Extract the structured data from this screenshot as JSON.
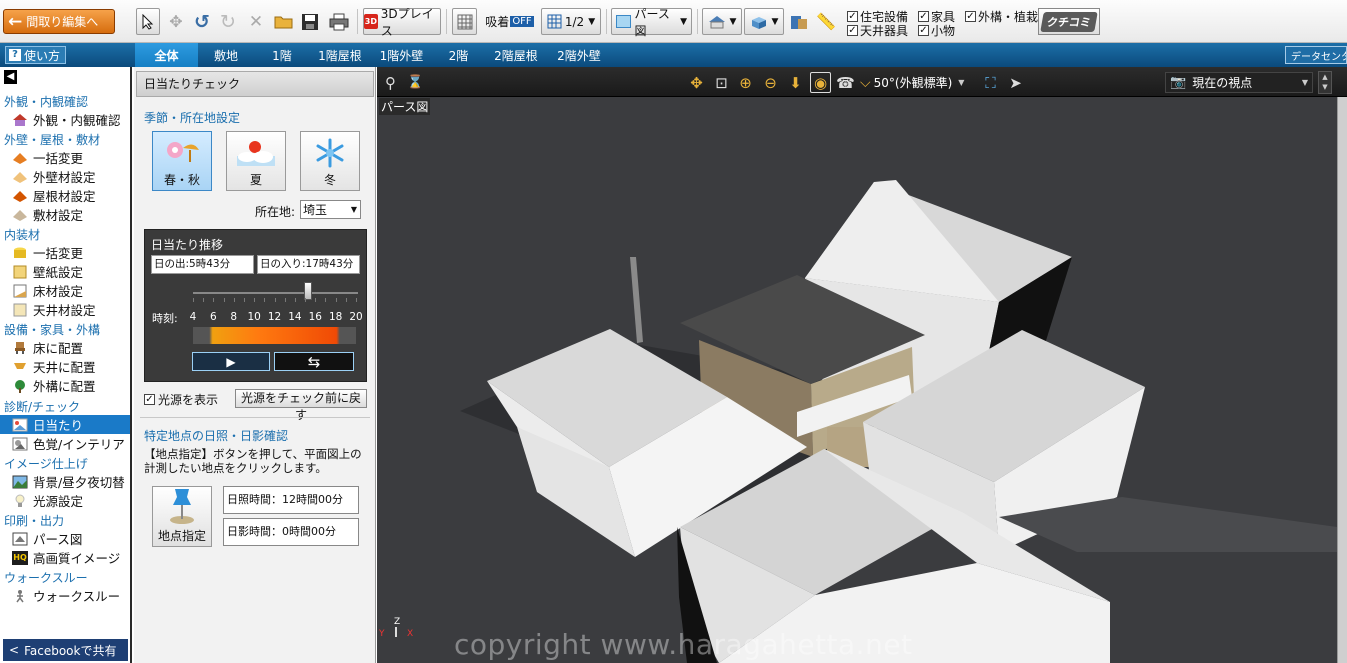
{
  "toolbar": {
    "madori_label": "間取り編集へ",
    "place3d_label": "3Dプレイス",
    "snap_label": "吸着",
    "snap_state": "OFF",
    "grid_label": "1/2",
    "view_label": "パース図",
    "checks": [
      {
        "label": "住宅設備",
        "checked": true
      },
      {
        "label": "家具",
        "checked": true
      },
      {
        "label": "外構・植栽",
        "checked": true
      },
      {
        "label": "天井器具",
        "checked": true
      },
      {
        "label": "小物",
        "checked": true
      }
    ],
    "kuchikomi_label": "クチコミ"
  },
  "tabbar": {
    "help_label": "使い方",
    "tabs": [
      "全体",
      "敷地",
      "1階",
      "1階屋根",
      "1階外壁",
      "2階",
      "2階屋根",
      "2階外壁"
    ],
    "selected_tab": "全体",
    "dataset_label": "データセンター"
  },
  "sidebar": {
    "sections": [
      {
        "title": "外観・内観確認",
        "items": [
          "外観・内観確認"
        ]
      },
      {
        "title": "外壁・屋根・敷材",
        "items": [
          "一括変更",
          "外壁材設定",
          "屋根材設定",
          "敷材設定"
        ]
      },
      {
        "title": "内装材",
        "items": [
          "一括変更",
          "壁紙設定",
          "床材設定",
          "天井材設定"
        ]
      },
      {
        "title": "設備・家具・外構",
        "items": [
          "床に配置",
          "天井に配置",
          "外構に配置"
        ]
      },
      {
        "title": "診断/チェック",
        "items": [
          "日当たり",
          "色覚/インテリア"
        ]
      },
      {
        "title": "イメージ仕上げ",
        "items": [
          "背景/昼夕夜切替",
          "光源設定"
        ]
      },
      {
        "title": "印刷・出力",
        "items": [
          "パース図",
          "高画質イメージ"
        ]
      },
      {
        "title": "ウォークスルー",
        "items": [
          "ウォークスルー"
        ]
      }
    ],
    "selected_item": "日当たり",
    "facebook_label": "Facebookで共有"
  },
  "panel": {
    "title": "日当たりチェック",
    "season_section": "季節・所在地設定",
    "seasons": [
      {
        "label": "春・秋",
        "icon": "cherry-blossom-icon"
      },
      {
        "label": "夏",
        "icon": "summer-sun-icon"
      },
      {
        "label": "冬",
        "icon": "snowflake-icon"
      }
    ],
    "selected_season": "春・秋",
    "location_label": "所在地:",
    "location_value": "埼玉",
    "sun": {
      "title": "日当たり推移",
      "sunrise": "日の出:5時43分",
      "sunset": "日の入り:17時43分",
      "time_label": "時刻:",
      "hours": [
        "4",
        "6",
        "8",
        "10",
        "12",
        "14",
        "16",
        "18",
        "20"
      ],
      "slider_hour": 15.3,
      "hour_min": 4,
      "hour_max": 20
    },
    "show_light_label": "光源を表示",
    "show_light_checked": true,
    "reset_light_label": "光源をチェック前に戻す",
    "point_section": "特定地点の日照・日影確認",
    "instructions": "【地点指定】ボタンを押して、平面図上の計測したい地点をクリックします。",
    "point_button_label": "地点指定",
    "sunshine_time": "日照時間：12時間00分",
    "shade_time": "日影時間：0時間00分"
  },
  "viewport": {
    "angle_label": "50°(外観標準)",
    "viewpoint_label": "現在の視点",
    "view_name": "パース図",
    "watermark": "copyright www.haragahetta.net",
    "axis_labels": {
      "x": "X",
      "y": "Y",
      "z": "Z"
    }
  },
  "colors": {
    "accent_blue": "#1a7ac8",
    "orange": "#e2801e",
    "viewport_bg": "#3b3c3f"
  }
}
